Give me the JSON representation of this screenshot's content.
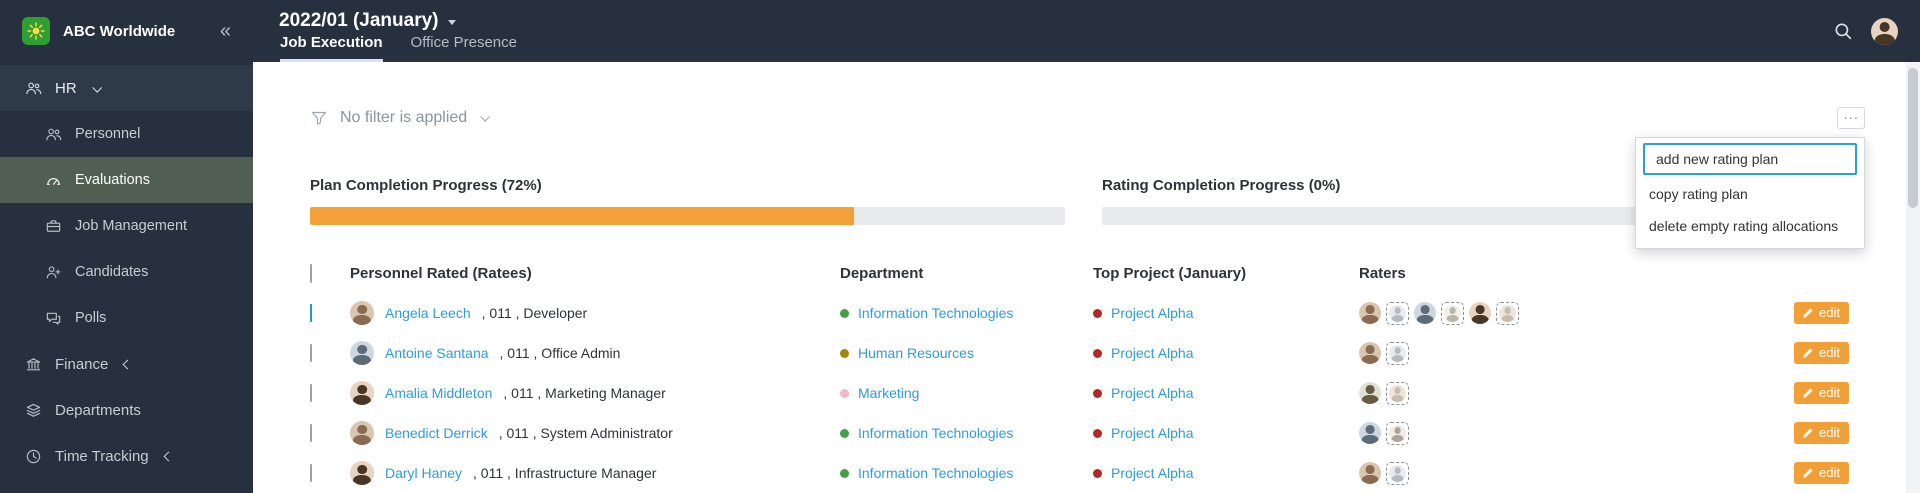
{
  "sidebar": {
    "brand": "ABC Worldwide",
    "items": [
      {
        "label": "HR",
        "expanded": true
      },
      {
        "label": "Personnel"
      },
      {
        "label": "Evaluations",
        "selected": true
      },
      {
        "label": "Job Management"
      },
      {
        "label": "Candidates"
      },
      {
        "label": "Polls"
      },
      {
        "label": "Finance",
        "collapsed": true
      },
      {
        "label": "Departments"
      },
      {
        "label": "Time Tracking",
        "collapsed": true
      }
    ]
  },
  "header": {
    "period": "2022/01 (January)",
    "tabs": [
      {
        "label": "Job Execution",
        "active": true
      },
      {
        "label": "Office Presence",
        "active": false
      }
    ]
  },
  "toolbar": {
    "filter_label": "No filter is applied",
    "more_label": "..."
  },
  "menu": {
    "items": [
      "add new rating plan",
      "copy rating plan",
      "delete empty rating allocations"
    ],
    "highlight_color": "#2b9fd6"
  },
  "progress": {
    "fill_color": "#f2a138",
    "track_color": "#e8eaed",
    "plan": {
      "label": "Plan Completion Progress (72%)",
      "percent": 72
    },
    "rating": {
      "label": "Rating Completion Progress (0%)",
      "percent": 0
    }
  },
  "table": {
    "headers": {
      "personnel": "Personnel Rated (Ratees)",
      "department": "Department",
      "project": "Top Project (January)",
      "raters": "Raters"
    },
    "edit_label": "edit",
    "link_color": "#2d9cdb",
    "rows": [
      {
        "checked": true,
        "name": "Angela Leech",
        "details": ", 011 , Developer",
        "department": "Information Technologies",
        "dept_color": "#43a047",
        "project": "Project Alpha",
        "project_color": "#b02a25",
        "raters": [
          "avatar",
          "placeholder",
          "avatar",
          "placeholder",
          "avatar",
          "placeholder"
        ]
      },
      {
        "checked": false,
        "name": "Antoine Santana",
        "details": ", 011 , Office Admin",
        "department": "Human Resources",
        "dept_color": "#a3850a",
        "project": "Project Alpha",
        "project_color": "#b02a25",
        "raters": [
          "avatar",
          "placeholder"
        ]
      },
      {
        "checked": false,
        "name": "Amalia Middleton",
        "details": ", 011 , Marketing Manager",
        "department": "Marketing",
        "dept_color": "#f4b8c8",
        "project": "Project Alpha",
        "project_color": "#b02a25",
        "raters": [
          "avatar",
          "placeholder"
        ]
      },
      {
        "checked": false,
        "name": "Benedict Derrick",
        "details": ", 011 , System Administrator",
        "department": "Information Technologies",
        "dept_color": "#43a047",
        "project": "Project Alpha",
        "project_color": "#b02a25",
        "raters": [
          "avatar",
          "placeholder"
        ]
      },
      {
        "checked": false,
        "name": "Daryl Haney",
        "details": ", 011 , Infrastructure Manager",
        "department": "Information Technologies",
        "dept_color": "#43a047",
        "project": "Project Alpha",
        "project_color": "#b02a25",
        "raters": [
          "avatar",
          "placeholder"
        ]
      }
    ]
  }
}
